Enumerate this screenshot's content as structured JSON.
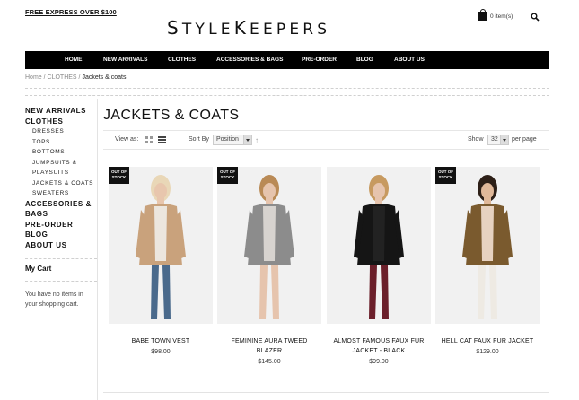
{
  "header": {
    "promo": "FREE EXPRESS OVER $100",
    "logo_parts": [
      "S",
      "TYLE",
      "K",
      "EEPERS"
    ],
    "cart_count": "0 item(s)"
  },
  "nav": [
    "HOME",
    "NEW ARRIVALS",
    "CLOTHES",
    "ACCESSORIES & BAGS",
    "PRE-ORDER",
    "BLOG",
    "ABOUT US"
  ],
  "breadcrumb": {
    "home": "Home",
    "sep1": " / ",
    "clothes": "CLOTHES",
    "sep2": " / ",
    "current": "Jackets & coats"
  },
  "sidebar": {
    "new_arrivals": "NEW ARRIVALS",
    "clothes": "CLOTHES",
    "sub": [
      "DRESSES",
      "TOPS",
      "BOTTOMS",
      "JUMPSUITS &",
      "PLAYSUITS",
      "JACKETS & COATS",
      "SWEATERS"
    ],
    "accessories_1": "ACCESSORIES &",
    "accessories_2": "BAGS",
    "preorder": "PRE-ORDER",
    "blog": "BLOG",
    "about": "ABOUT US",
    "cart_title": "My Cart",
    "cart_msg": "You have no items in your shopping cart."
  },
  "main": {
    "title": "JACKETS & COATS",
    "view_as": "View as:",
    "sort_by": "Sort By",
    "sort_value": "Position",
    "show": "Show",
    "show_value": "32",
    "per_page": "per page"
  },
  "products": [
    {
      "name": "BABE TOWN VEST",
      "price": "$98.00",
      "badge": "OUT OF STOCK",
      "colors": {
        "bg": "#f1f1f1",
        "coat": "#c9a27c",
        "top": "#ece6de",
        "legs": "#4a6a8c",
        "hair": "#e9d7b7",
        "skin": "#e8c6ad"
      }
    },
    {
      "name": "FEMININE AURA TWEED BLAZER",
      "price": "$145.00",
      "badge": "OUT OF STOCK",
      "colors": {
        "bg": "#f1f1f1",
        "coat": "#8c8c8c",
        "top": "#d7d3cf",
        "legs": "#e6c4ad",
        "hair": "#b98a56",
        "skin": "#e6c4ad"
      }
    },
    {
      "name": "ALMOST FAMOUS FAUX FUR JACKET - BLACK",
      "price": "$99.00",
      "badge": "",
      "colors": {
        "bg": "#f1f1f1",
        "coat": "#151515",
        "top": "#222",
        "legs": "#6b1f2a",
        "hair": "#c79a60",
        "skin": "#e6c4ad"
      }
    },
    {
      "name": "HELL CAT FAUX FUR JACKET",
      "price": "$129.00",
      "badge": "OUT OF STOCK",
      "colors": {
        "bg": "#f1f1f1",
        "coat": "#7a5a2e",
        "top": "#e7d2c0",
        "legs": "#eeeae3",
        "hair": "#2d1f17",
        "skin": "#e0b899"
      }
    }
  ]
}
